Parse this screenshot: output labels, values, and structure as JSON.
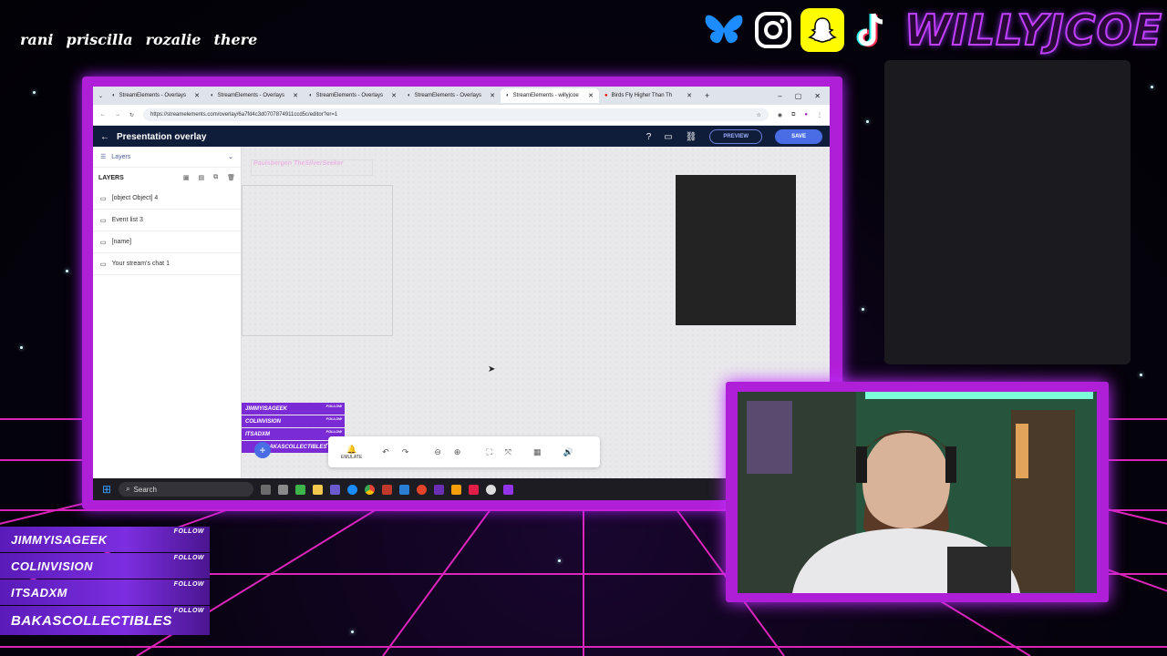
{
  "overlay": {
    "names": [
      "rani",
      "priscilla",
      "rozalie",
      "there"
    ],
    "brand": "WILLYJCOE",
    "social_icons": [
      "bluesky-icon",
      "instagram-icon",
      "snapchat-icon",
      "tiktok-icon"
    ],
    "followers": [
      {
        "name": "JIMMYISAGEEK",
        "follow": "FOLLOW"
      },
      {
        "name": "COLINVISION",
        "follow": "FOLLOW"
      },
      {
        "name": "ITSADXM",
        "follow": "FOLLOW"
      },
      {
        "name": "BAKASCOLLECTIBLES",
        "follow": "FOLLOW"
      }
    ],
    "accent_color": "#b01fd8"
  },
  "browser": {
    "tabs": [
      {
        "label": "StreamElements - Overlays",
        "active": false
      },
      {
        "label": "StreamElements - Overlays",
        "active": false
      },
      {
        "label": "StreamElements - Overlays",
        "active": false
      },
      {
        "label": "StreamElements - Overlays",
        "active": false
      },
      {
        "label": "StreamElements - willyjcoe",
        "active": true
      },
      {
        "label": "Birds Fly Higher Than Th",
        "active": false
      }
    ],
    "url": "https://streamelements.com/overlay/6a7fd4c3d0707874911ccd5c/editor?er=1"
  },
  "editor": {
    "title": "Presentation overlay",
    "preview_label": "PREVIEW",
    "save_label": "SAVE",
    "panel_label": "Layers",
    "layers_heading": "LAYERS",
    "layers": [
      "[object Object] 4",
      "Event list 3",
      "[name]",
      "Your stream's chat 1"
    ],
    "ghost_title": "Paulsbergen  TheSilverSeeker",
    "mini_followers": [
      "JIMMYISAGEEK",
      "COLINVISION",
      "ITSADXM",
      "BAKASCOLLECTIBLES"
    ],
    "mini_follow": "FOLLOW",
    "emulate_label": "EMULATE"
  },
  "taskbar": {
    "search_label": "Search"
  }
}
